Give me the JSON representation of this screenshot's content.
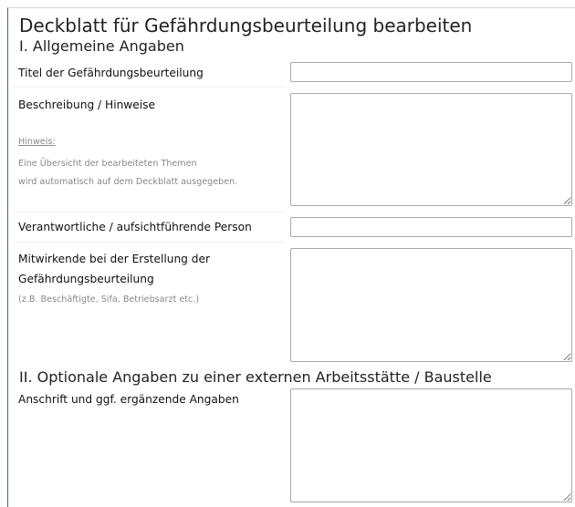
{
  "page": {
    "title": "Deckblatt für Gefährdungsbeurteilung bearbeiten"
  },
  "section1": {
    "title": "I. Allgemeine Angaben",
    "fields": {
      "titel": {
        "label": "Titel der Gefährdungsbeurteilung",
        "value": ""
      },
      "beschreibung": {
        "label": "Beschreibung / Hinweise",
        "hint_heading": "Hinweis:",
        "hint_line1": "Eine Übersicht der bearbeiteten Themen",
        "hint_line2": "wird automatisch auf dem Deckblatt ausgegeben.",
        "value": ""
      },
      "verantwortliche": {
        "label": "Verantwortliche / aufsichtführende Person",
        "value": ""
      },
      "mitwirkende": {
        "label_line1": "Mitwirkende bei der Erstellung der",
        "label_line2": "Gefährdungsbeurteilung",
        "hint": "(z.B. Beschäftigte, Sifa, Betriebsarzt etc.)",
        "value": ""
      }
    }
  },
  "section2": {
    "title": "II. Optionale Angaben zu einer externen Arbeitsstätte / Baustelle",
    "fields": {
      "anschrift": {
        "label": "Anschrift und ggf. ergänzende Angaben",
        "value": ""
      }
    }
  }
}
